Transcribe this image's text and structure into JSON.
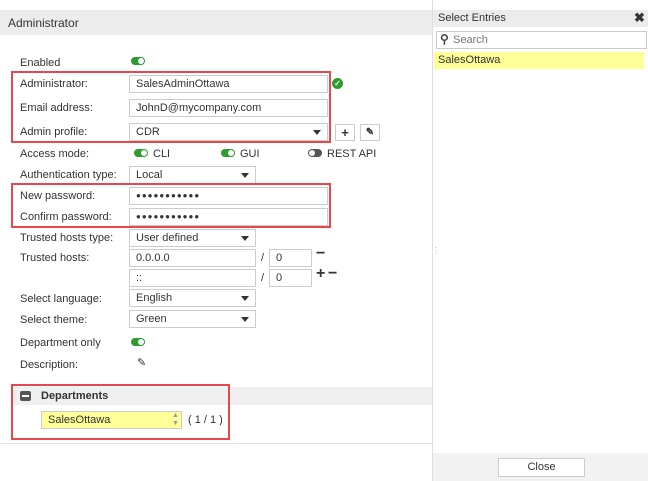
{
  "header": {
    "title": "Administrator"
  },
  "form": {
    "enabled_label": "Enabled",
    "enabled": true,
    "administrator_label": "Administrator:",
    "administrator_value": "SalesAdminOttawa",
    "email_label": "Email address:",
    "email_value": "JohnD@mycompany.com",
    "profile_label": "Admin profile:",
    "profile_value": "CDR",
    "access_label": "Access mode:",
    "access_cli": "CLI",
    "access_gui": "GUI",
    "access_rest": "REST API",
    "auth_label": "Authentication type:",
    "auth_value": "Local",
    "newpw_label": "New password:",
    "newpw_value": "●●●●●●●●●●●",
    "confirmpw_label": "Confirm password:",
    "confirmpw_value": "●●●●●●●●●●●",
    "trusted_type_label": "Trusted hosts type:",
    "trusted_type_value": "User defined",
    "trusted_label": "Trusted hosts:",
    "hosts": [
      {
        "ip": "0.0.0.0",
        "mask": "0"
      },
      {
        "ip": "::",
        "mask": "0"
      }
    ],
    "slash": "/",
    "language_label": "Select language:",
    "language_value": "English",
    "theme_label": "Select theme:",
    "theme_value": "Green",
    "dept_only_label": "Department only",
    "description_label": "Description:"
  },
  "departments": {
    "title": "Departments",
    "value": "SalesOttawa",
    "count": "( 1 / 1 )"
  },
  "side": {
    "title": "Select Entries",
    "search_placeholder": "Search",
    "items": [
      "SalesOttawa"
    ],
    "close": "Close"
  },
  "colors": {
    "accent": "#2e9b2e",
    "highlight": "#ffff99",
    "red": "#e8474c"
  }
}
